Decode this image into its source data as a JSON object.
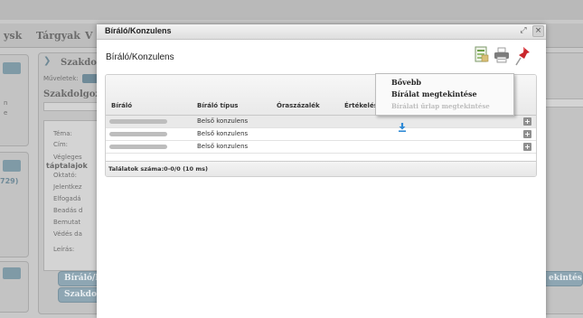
{
  "background": {
    "tabs": [
      "ysk",
      "Tárgyak",
      "V"
    ],
    "panel_heading": "Szakdol",
    "actions_label": "Műveletek:",
    "section_title": "Szakdolgozat",
    "fields": [
      "Téma:",
      "Cím:",
      "Végleges",
      "táptalajok",
      "Oktató:",
      "Jelentkez",
      "Elfogadá",
      "Beadás d",
      "Bemutat",
      "Védés da",
      "Leírás:"
    ],
    "left_codes": [
      "n",
      "e",
      "729)"
    ],
    "buttons": [
      "Bíráló/K",
      "Szakdolg",
      "ekintése"
    ]
  },
  "modal": {
    "header_title": "Bíráló/Konzulens",
    "restore_glyph": "⤢",
    "close_glyph": "×",
    "title": "Bíráló/Konzulens",
    "toolbar_icons": [
      "excel-export-icon",
      "print-icon",
      "pin-icon"
    ],
    "grid": {
      "columns": [
        "Bíráló",
        "Bíráló típus",
        "Óraszázalék",
        "Értékelés"
      ],
      "rows": [
        {
          "reviewer": "",
          "type": "Belső konzulens"
        },
        {
          "reviewer": "",
          "type": "Belső konzulens"
        },
        {
          "reviewer": "",
          "type": "Belső konzulens"
        }
      ],
      "footer": "Találatok száma:0-0/0 (10 ms)"
    }
  },
  "context_menu": {
    "items": [
      "Bővebb",
      "Bírálat megtekintése",
      "Bírálati űrlap megtekintése"
    ],
    "disabled_index": 2
  },
  "colors": {
    "overlay_gray": "#c9c9c9",
    "accent_blue": "#2f8ad6",
    "plus_gray": "#8f8f8f"
  }
}
